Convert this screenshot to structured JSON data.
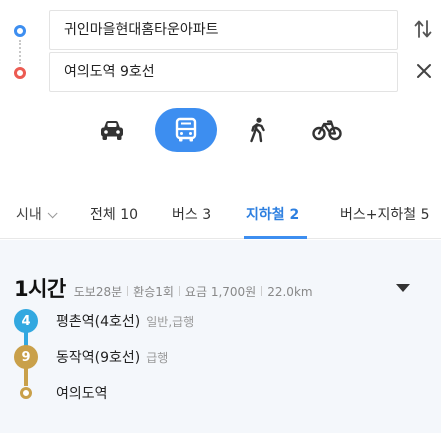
{
  "route": {
    "start": "귀인마을현대홈타운아파트",
    "end": "여의도역 9호선"
  },
  "tabs": {
    "region": "시내",
    "all": "전체 10",
    "bus": "버스 3",
    "subway": "지하철 2",
    "mixed": "버스+지하철 5"
  },
  "result": {
    "duration": "1시간",
    "walk": "도보28분",
    "transfer": "환승1회",
    "fare": "요금 1,700원",
    "distance": "22.0km",
    "stops": [
      {
        "badge": "4",
        "name": "평촌역(4호선)",
        "type": "일반,급행",
        "color": "#32a8e0"
      },
      {
        "badge": "9",
        "name": "동작역(9호선)",
        "type": "급행",
        "color": "#c9a04a"
      },
      {
        "name": "여의도역"
      }
    ]
  },
  "colors": {
    "accent": "#3d8ef0",
    "start_dot": "#3d8ef0",
    "end_dot": "#ec5b52",
    "line4": "#32a8e0",
    "line9": "#c9a04a"
  },
  "icons": {
    "swap": "swap-vertical-icon",
    "clear": "close-icon",
    "car": "car-icon",
    "bus": "bus-icon",
    "walk": "walk-icon",
    "bike": "bicycle-icon",
    "expand": "caret-down-icon"
  }
}
